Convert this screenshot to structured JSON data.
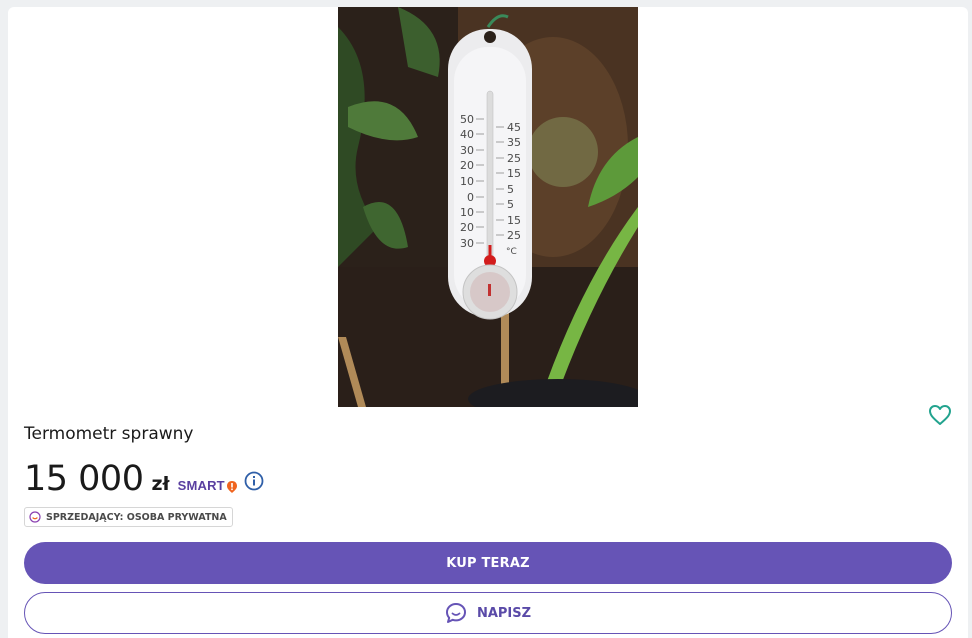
{
  "listing": {
    "title": "Termometr sprawny",
    "price": "15 000",
    "currency": "zł",
    "smart_label": "SMART",
    "seller_type": "SPRZEDAJĄCY: OSOBA PRYWATNA"
  },
  "actions": {
    "buy_label": "KUP TERAZ",
    "message_label": "NAPISZ"
  },
  "icons": {
    "favorite": "heart-icon",
    "info": "info-icon",
    "seller": "smiley-icon",
    "message": "chat-bubble-icon"
  },
  "colors": {
    "accent": "#6654b6",
    "favorite": "#22a38e",
    "info": "#2f5fa8",
    "smart_badge": "#f0641e"
  },
  "photo": {
    "scale_left": [
      "50",
      "40",
      "30",
      "20",
      "10",
      "0",
      "10",
      "20",
      "30"
    ],
    "scale_right": [
      "45",
      "35",
      "25",
      "15",
      "5",
      "5",
      "15",
      "25"
    ],
    "unit": "°C"
  }
}
